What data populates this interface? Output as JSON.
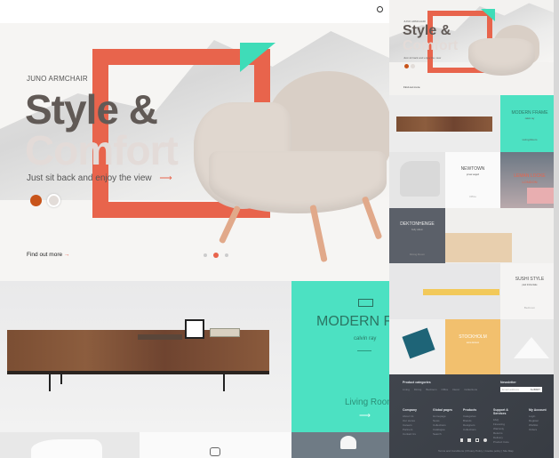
{
  "hero": {
    "eyebrow": "JUNO ARMCHAIR",
    "title_line1": "Style &",
    "title_line2": "Comfort",
    "subtitle": "Just sit back and enjoy the view",
    "arrow": "⟶",
    "cta": "Find out more",
    "cta_arrow": "→",
    "color_options": [
      "#c8541a",
      "#e2dcd8"
    ],
    "slide_count": 3,
    "active_slide": 2
  },
  "header": {
    "search_icon": "search-icon"
  },
  "featured": {
    "title": "MODERN FRAME",
    "designer": "calvin ray",
    "category": "Living Room",
    "arrow": "⟶"
  },
  "thumbnail": {
    "hero": {
      "eyebrow": "JUNO ARMCHAIR",
      "title_line1": "Style &",
      "title_line2": "Comfort",
      "subtitle": "Just sit back and enjoy the view",
      "cta": "Find out more"
    },
    "tiles": [
      {
        "title": "MODERN FRAME",
        "sub": "calvin ray",
        "cat": "Living Room"
      },
      {
        "title": "NEWTOWN",
        "sub": "jonas wagell",
        "cat": "Office"
      },
      {
        "title": "LEMAN LOCKE",
        "sub": "LONDON"
      },
      {
        "title": "DEKTONHENGE",
        "sub": "Kelly wilson",
        "cat": "Dining Room"
      },
      {
        "title": "SUSHI STYLE",
        "sub": "paul timberlake",
        "cat": "Bedroom"
      },
      {
        "title": "STOCKHOLM",
        "sub": "anna larsson",
        "cat": "Decor"
      }
    ],
    "footer": {
      "categories_title": "Product categories",
      "categories": [
        "Living",
        "Dining",
        "Bedroom",
        "Office",
        "Decor",
        "Collections"
      ],
      "newsletter_title": "Newsletter",
      "newsletter_placeholder": "Email address",
      "newsletter_button": "SUBMIT",
      "columns": [
        {
          "title": "Company",
          "links": [
            "About Us",
            "Our stores",
            "Careers",
            "Partners",
            "Contact Us"
          ]
        },
        {
          "title": "Global pages",
          "links": [
            "Homepage",
            "News",
            "Collections",
            "Catalogue",
            "Search"
          ]
        },
        {
          "title": "Products",
          "links": [
            "Categories",
            "Brands",
            "Designers",
            "Collections"
          ]
        },
        {
          "title": "Support & Services",
          "links": [
            "FAQ",
            "Financing",
            "Warranty",
            "Returns",
            "Delivery",
            "Product Care"
          ]
        },
        {
          "title": "My Account",
          "links": [
            "Login",
            "Register",
            "Wishlist",
            "Orders"
          ]
        }
      ],
      "legal": "Terms and Conditions | Privacy Policy | Cookie policy | Site Map"
    }
  }
}
